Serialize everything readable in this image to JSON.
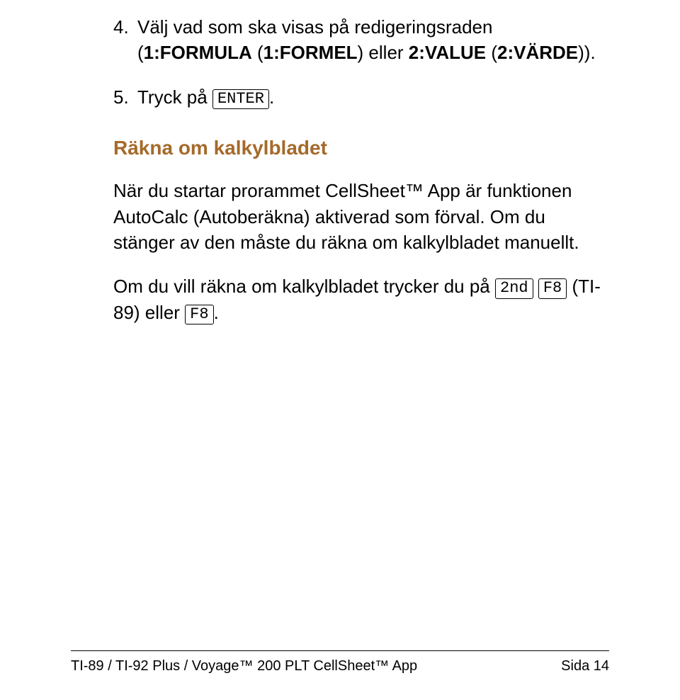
{
  "list": {
    "item4": {
      "num": "4.",
      "t1": "Välj vad som ska visas på redigeringsraden (",
      "b1": "1:FORMULA",
      "t2": " (",
      "b2": "1:FORMEL",
      "t3": ") eller ",
      "b3": "2:VALUE",
      "t4": " (",
      "b4": "2:VÄRDE",
      "t5": ")).",
      "_full": "Välj vad som ska visas på redigeringsraden (1:FORMULA (1:FORMEL) eller 2:VALUE (2:VÄRDE))."
    },
    "item5": {
      "num": "5.",
      "t1": "Tryck på ",
      "key1": "ENTER",
      "t2": ".",
      "_full": "Tryck på ENTER."
    }
  },
  "heading": "Räkna om kalkylbladet",
  "para1": "När du startar prorammet CellSheet™ App är funktionen AutoCalc (Autoberäkna) aktiverad som förval. Om du stänger av den måste du räkna om kalkylbladet manuellt.",
  "para2": {
    "t1": "Om du vill räkna om kalkylbladet trycker du på ",
    "key1": "2nd",
    "t2": " ",
    "key2": "F8",
    "t3": " (TI-89) eller ",
    "key3": "F8",
    "t4": ".",
    "_full": "Om du vill räkna om kalkylbladet trycker du på 2nd [F8] (TI-89) eller F8."
  },
  "footer": {
    "left": "TI-89 / TI-92 Plus / Voyage™ 200 PLT CellSheet™ App",
    "right": "Sida 14"
  }
}
